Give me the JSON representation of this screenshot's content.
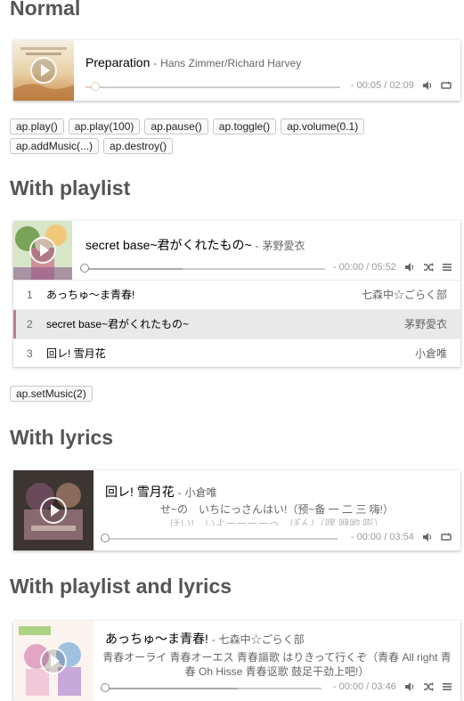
{
  "sections": {
    "normal": "Normal",
    "playlist": "With playlist",
    "lyrics": "With lyrics",
    "playlist_lyrics": "With playlist and lyrics"
  },
  "player1": {
    "title": "Preparation",
    "author": "Hans Zimmer/Richard Harvey",
    "time": "- 00:05 / 02:09",
    "progress": 0.04,
    "theme": "#e6d0b2",
    "icons": [
      "volume-icon",
      "loop-icon"
    ]
  },
  "api_buttons_1": [
    "ap.play()",
    "ap.play(100)",
    "ap.pause()",
    "ap.toggle()",
    "ap.volume(0.1)",
    "ap.addMusic(...)",
    "ap.destroy()"
  ],
  "player2": {
    "title": "secret base~君がくれたもの~",
    "author": "茅野愛衣",
    "time": "- 00:00 / 05:52",
    "progress": 0.0,
    "loaded": 0.42,
    "theme": "#b7828c",
    "icons": [
      "volume-icon",
      "shuffle-icon",
      "menu-icon"
    ],
    "playlist": [
      {
        "index": "1",
        "title": "あっちゅ～ま青春!",
        "artist": "七森中☆ごらく部"
      },
      {
        "index": "2",
        "title": "secret base~君がくれたもの~",
        "artist": "茅野愛衣"
      },
      {
        "index": "3",
        "title": "回レ! 雪月花",
        "artist": "小倉唯"
      }
    ],
    "active_index": 1
  },
  "api_buttons_2": [
    "ap.setMusic(2)"
  ],
  "player3": {
    "title": "回レ! 雪月花",
    "author": "小倉唯",
    "lyric_current": "せ~の　いちにっさんはい!（预~备 一 二 三 嗨!）",
    "lyric_next": "ほい!　いよーーーーっ　ぽん!（嘿 咿哟 嘭）",
    "time": "- 00:00 / 03:54",
    "progress": 0.0,
    "theme": "#3d3532",
    "icons": [
      "volume-icon",
      "loop-icon"
    ]
  },
  "player4": {
    "title": "あっちゅ～ま青春!",
    "author": "七森中☆ごらく部",
    "lyric_current": "青春オーライ 青春オーエス 青春謳歌 はりきって行くぞ（青春 All right 青",
    "lyric_next": "春 Oh Hisse 青春讴歌 鼓足干劲上吧!）",
    "time": "- 00:00 / 03:46",
    "progress": 0.0,
    "loaded": 0.62,
    "theme": "#e2a6c4",
    "icons": [
      "volume-icon",
      "shuffle-icon",
      "menu-icon"
    ]
  }
}
